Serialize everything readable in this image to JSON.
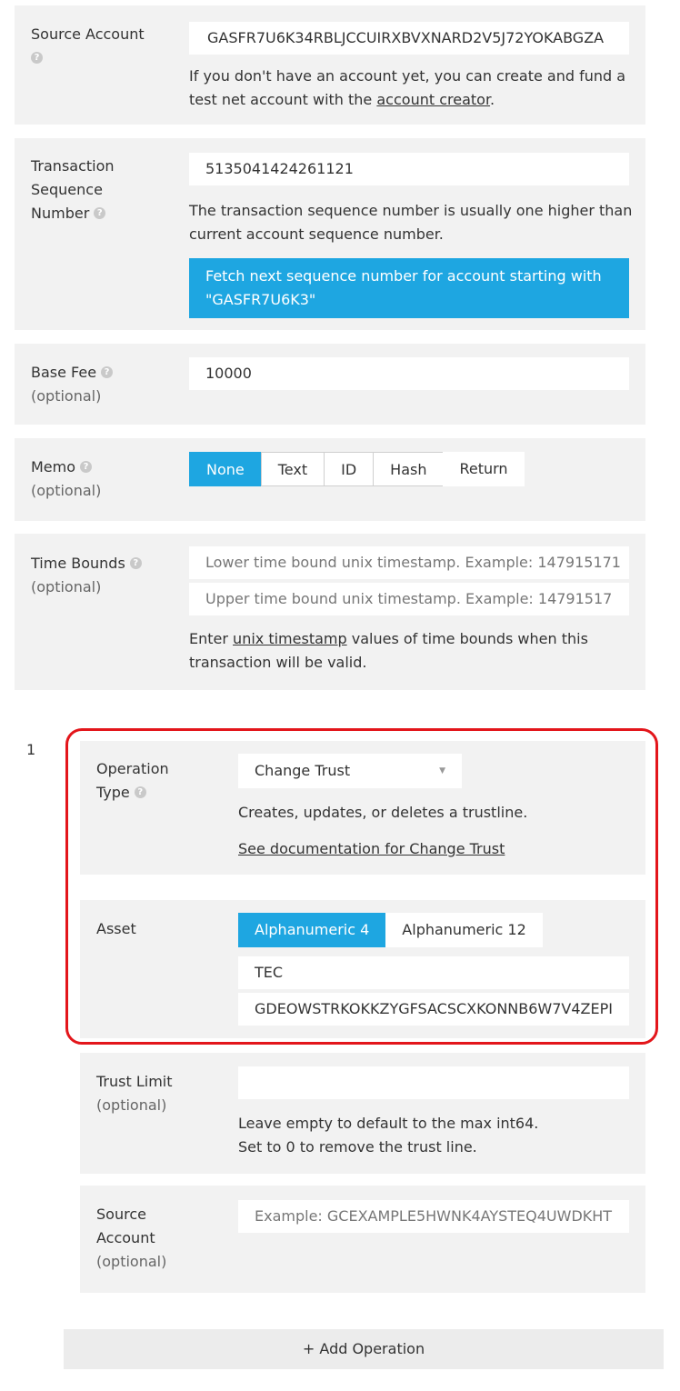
{
  "source_account": {
    "label": "Source Account",
    "help_icon": "question-icon",
    "value": "GASFR7U6K34RBLJCCUIRXBVXNARD2V5J72YOKABGZA",
    "note_prefix": "If you don't have an account yet, you can create and fund a test net account with the",
    "note_link": "account creator",
    "note_suffix": "."
  },
  "sequence": {
    "label_line1": "Transaction",
    "label_line2": "Sequence",
    "label_line3": "Number",
    "value": "5135041424261121",
    "note": "The transaction sequence number is usually one higher than current account sequence number.",
    "fetch_button": "Fetch next sequence number for account starting with \"GASFR7U6K3\""
  },
  "base_fee": {
    "label": "Base Fee",
    "optional": "(optional)",
    "value": "10000"
  },
  "memo": {
    "label": "Memo",
    "optional": "(optional)",
    "options": [
      "None",
      "Text",
      "ID",
      "Hash",
      "Return"
    ],
    "selected": "None"
  },
  "time_bounds": {
    "label": "Time Bounds",
    "optional": "(optional)",
    "lower_placeholder": "Lower time bound unix timestamp. Example: 147915171",
    "upper_placeholder": "Upper time bound unix timestamp.  Example: 14791517",
    "note_prefix": "Enter",
    "note_link": "unix timestamp",
    "note_suffix": "values of time bounds when this transaction will be valid."
  },
  "operation": {
    "index": "1",
    "type_label_line1": "Operation",
    "type_label_line2": "Type",
    "type_value": "Change Trust",
    "type_description": "Creates, updates, or deletes a trustline.",
    "doc_link": "See documentation for Change Trust",
    "asset_label": "Asset",
    "asset_options": [
      "Alphanumeric 4",
      "Alphanumeric 12"
    ],
    "asset_selected": "Alphanumeric 4",
    "asset_code": "TEC",
    "asset_issuer": "GDEOWSTRKOKKZYGFSACSCXKONNB6W7V4ZEPI",
    "trust_limit_label": "Trust Limit",
    "trust_limit_optional": "(optional)",
    "trust_limit_note_line1": "Leave empty to default to the max int64.",
    "trust_limit_note_line2": "Set to 0 to remove the trust line.",
    "source_label_line1": "Source",
    "source_label_line2": "Account",
    "source_optional": "(optional)",
    "source_placeholder": "Example: GCEXAMPLE5HWNK4AYSTEQ4UWDKHT"
  },
  "add_operation": "+ Add Operation",
  "colors": {
    "accent": "#1ea6e1",
    "panel": "#f2f2f2",
    "highlight": "#e3161b"
  }
}
